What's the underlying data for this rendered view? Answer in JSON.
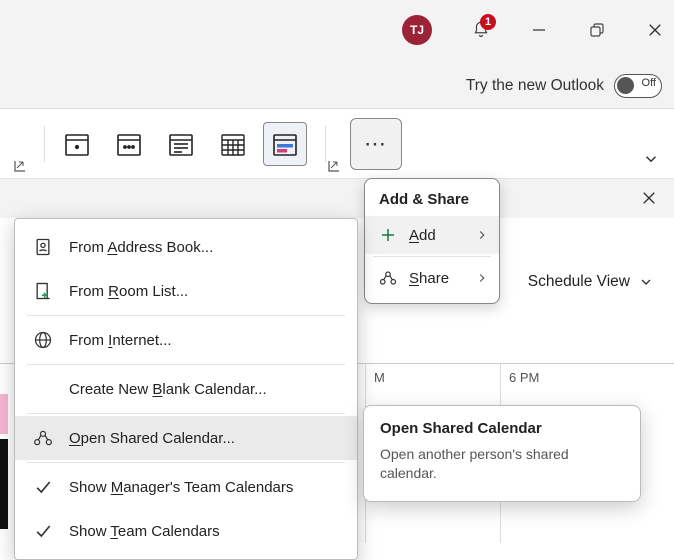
{
  "titlebar": {
    "avatar_initials": "TJ",
    "notification_count": "1",
    "try_new_label": "Try the new Outlook",
    "toggle_label": "Off"
  },
  "ribbon": {
    "ellipsis_glyph": "⋯"
  },
  "schedule_view_label": "Schedule View",
  "timegrid": {
    "col1": "M",
    "col2": "6 PM"
  },
  "addshare": {
    "title": "Add & Share",
    "add_prefix": "A",
    "add_rest": "dd",
    "share_prefix": "S",
    "share_rest": "hare"
  },
  "ctx": {
    "items": [
      {
        "pre": "From ",
        "u": "A",
        "post": "ddress Book..."
      },
      {
        "pre": "From ",
        "u": "R",
        "post": "oom List..."
      },
      {
        "pre": "From ",
        "u": "I",
        "post": "nternet..."
      },
      {
        "pre": "Create New ",
        "u": "B",
        "post": "lank Calendar..."
      },
      {
        "pre": "",
        "u": "O",
        "post": "pen Shared Calendar..."
      },
      {
        "pre": "Show ",
        "u": "M",
        "post": "anager's Team Calendars"
      },
      {
        "pre": "Show ",
        "u": "T",
        "post": "eam Calendars"
      }
    ]
  },
  "tooltip": {
    "title": "Open Shared Calendar",
    "body": "Open another person's shared calendar."
  }
}
